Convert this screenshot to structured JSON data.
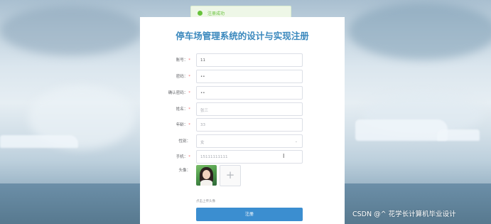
{
  "toast": {
    "icon": "success-check-icon",
    "text": "注册成功"
  },
  "form": {
    "title": "停车场管理系统的设计与实现注册",
    "fields": [
      {
        "label": "账号",
        "value": "11"
      },
      {
        "label": "密码",
        "value": "••"
      },
      {
        "label": "确认密码",
        "value": "••"
      },
      {
        "label": "姓名",
        "value": "张三"
      },
      {
        "label": "年龄",
        "value": "33"
      },
      {
        "label": "性别",
        "value": "女"
      },
      {
        "label": "手机",
        "value": "15111111111"
      }
    ],
    "avatar_label": "头像",
    "avatar_icon": "user-photo",
    "upload_icon": "plus-icon",
    "upload_symbol": "+",
    "upload_tip": "点击上传头像",
    "submit_label": "注册"
  },
  "watermark": "CSDN @^ 花学长计算机毕业设计",
  "colors": {
    "title": "#3a88bd",
    "submit": "#3b8ed0",
    "success": "#67c23a",
    "required": "#f56c6c"
  }
}
